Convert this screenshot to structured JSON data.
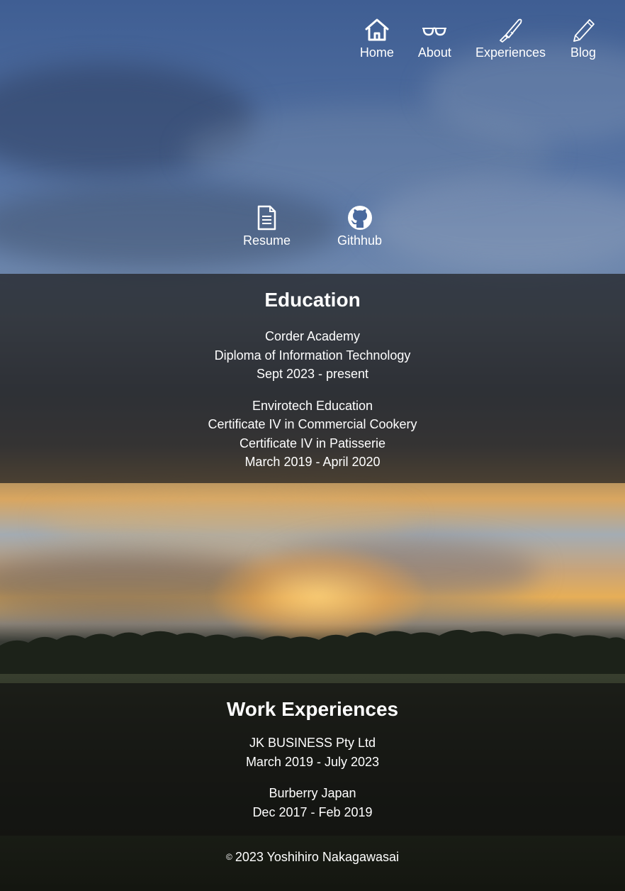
{
  "nav": {
    "items": [
      {
        "label": "Home",
        "icon": "home-icon"
      },
      {
        "label": "About",
        "icon": "glasses-icon"
      },
      {
        "label": "Experiences",
        "icon": "knife-icon"
      },
      {
        "label": "Blog",
        "icon": "pencil-icon"
      }
    ]
  },
  "links": {
    "items": [
      {
        "label": "Resume",
        "icon": "document-icon"
      },
      {
        "label": "Githhub",
        "icon": "github-icon"
      }
    ]
  },
  "education": {
    "title": "Education",
    "entries": [
      {
        "lines": [
          "Corder Academy",
          "Diploma of Information Technology",
          "Sept 2023 - present"
        ]
      },
      {
        "lines": [
          "Envirotech Education",
          "Certificate IV in Commercial Cookery",
          "Certificate IV in Patisserie",
          "March 2019 - April 2020"
        ]
      }
    ]
  },
  "work": {
    "title": "Work Experiences",
    "entries": [
      {
        "lines": [
          "JK BUSINESS Pty Ltd",
          "March 2019 - July 2023"
        ]
      },
      {
        "lines": [
          "Burberry Japan",
          "Dec 2017 - Feb 2019"
        ]
      }
    ]
  },
  "footer": {
    "symbol": "©",
    "text": "2023 Yoshihiro Nakagawasai"
  },
  "colors": {
    "text": "#ffffff",
    "panel": "#1e1e20"
  }
}
